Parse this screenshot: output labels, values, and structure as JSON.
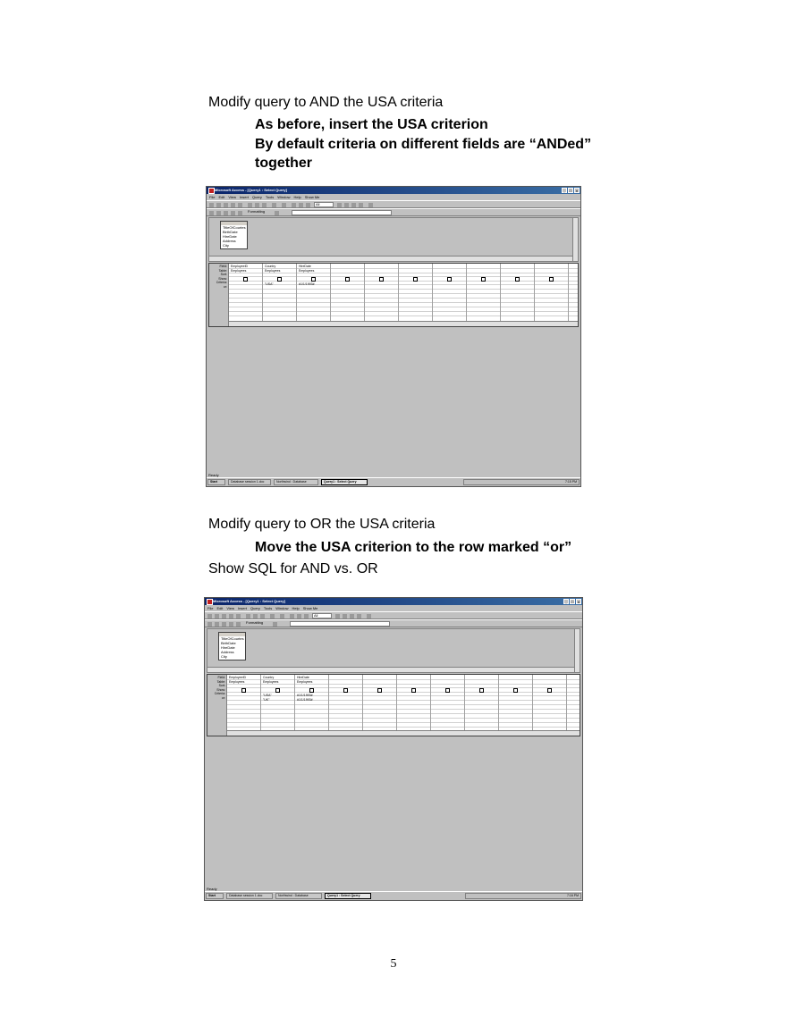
{
  "section1": {
    "heading": "Modify query to AND the USA criteria",
    "bullets": [
      "As before, insert the USA criterion",
      "By default criteria on different fields are “ANDed”",
      "together"
    ]
  },
  "section2": {
    "heading": "Modify query to OR the USA criteria",
    "bullet": "Move the USA criterion to the row marked “or”",
    "note": "Show SQL for AND vs. OR"
  },
  "page_number": "5",
  "screenshot1": {
    "window_title": "Microsoft Access - [Query1 : Select Query]",
    "menu": [
      "File",
      "Edit",
      "View",
      "Insert",
      "Query",
      "Tools",
      "Window",
      "Help",
      "Show Me"
    ],
    "toolbar_combo": "All",
    "formatting_label": "Formatting",
    "field_list": [
      "TitleOfCourtes",
      "BirthDate",
      "HireDate",
      "Address",
      "City"
    ],
    "row_labels": [
      "Field:",
      "Table:",
      "Sort:",
      "Show:",
      "Criteria:",
      "or:"
    ],
    "columns": [
      {
        "field": "EmployeeID",
        "table": "Employees",
        "criteria": "",
        "or": ""
      },
      {
        "field": "Country",
        "table": "Employees",
        "criteria": "\"USA\"",
        "or": ""
      },
      {
        "field": "HireDate",
        "table": "Employees",
        "criteria": "#1/1/1993#",
        "or": ""
      }
    ],
    "status": "Ready",
    "taskbar": [
      "Start",
      "Database session 1.doc",
      "Northwind : Database",
      "Query1 : Select Query"
    ],
    "clock": "7:15 PM"
  },
  "screenshot2": {
    "window_title": "Microsoft Access - [Query1 : Select Query]",
    "menu": [
      "File",
      "Edit",
      "View",
      "Insert",
      "Query",
      "Tools",
      "Window",
      "Help",
      "Show Me"
    ],
    "toolbar_combo": "All",
    "formatting_label": "Formatting",
    "field_list": [
      "TitleOfCourtes",
      "BirthDate",
      "HireDate",
      "Address",
      "City"
    ],
    "row_labels": [
      "Field:",
      "Table:",
      "Sort:",
      "Show:",
      "Criteria:",
      "or:"
    ],
    "columns": [
      {
        "field": "EmployeeID",
        "table": "Employees",
        "criteria": "",
        "or": ""
      },
      {
        "field": "Country",
        "table": "Employees",
        "criteria": "\"USA\"",
        "or": "\"UK\""
      },
      {
        "field": "HireDate",
        "table": "Employees",
        "criteria": "#1/1/1993#",
        "or": "#1/1/1993#"
      }
    ],
    "status": "Ready",
    "taskbar": [
      "Start",
      "Database session 1.doc",
      "Northwind : Database",
      "Query1 : Select Query"
    ],
    "clock": "7:16 PM"
  }
}
